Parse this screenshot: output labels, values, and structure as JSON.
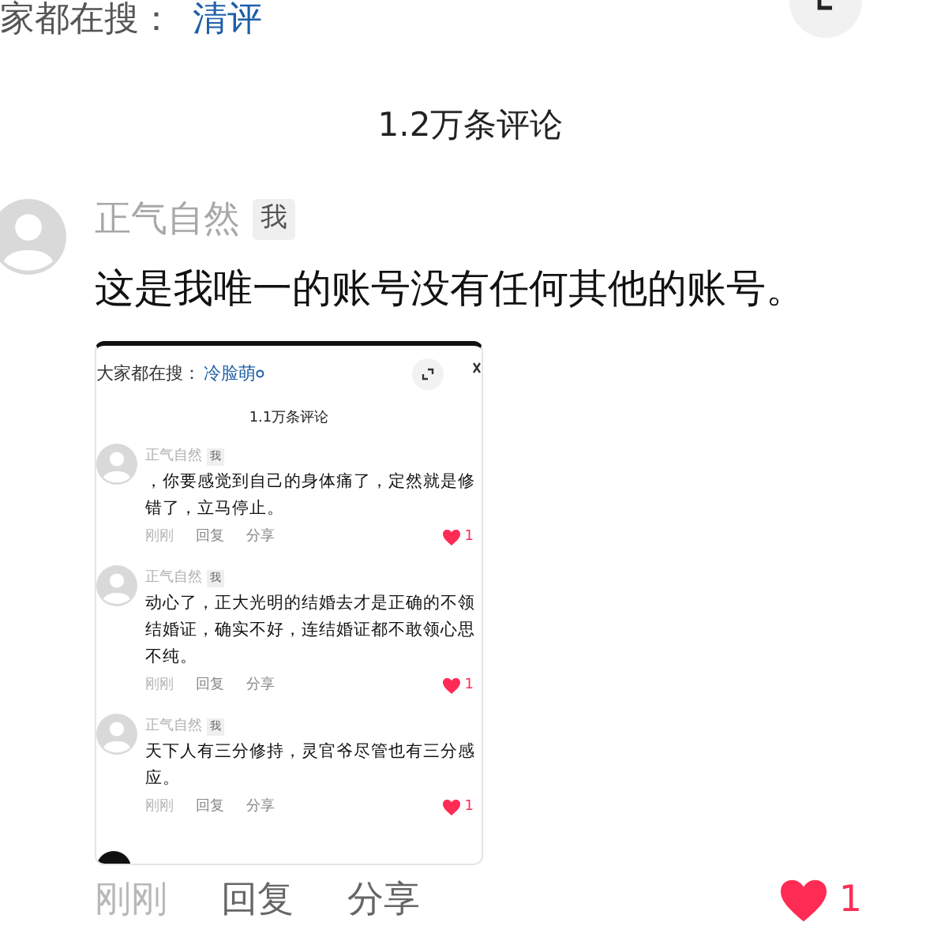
{
  "search_bar": {
    "label": "家都在搜：",
    "keyword": "清评"
  },
  "comment_count": "1.2万条评论",
  "comment": {
    "author": "正气自然",
    "badge": "我",
    "text": "这是我唯一的账号没有任何其他的账号。",
    "time": "刚刚",
    "actions": [
      "回复",
      "分享"
    ],
    "likes": "1",
    "liked": true,
    "screenshot": {
      "search_label": "大家都在搜：",
      "keyword": "冷脸萌",
      "comment_count": "1.1万条评论",
      "comments": [
        {
          "author": "正气自然",
          "badge": "我",
          "text": "，你要感觉到自己的身体痛了，定然就是修错了，立马停止。",
          "time": "刚刚",
          "actions": [
            "回复",
            "分享"
          ],
          "likes": "1",
          "liked": true
        },
        {
          "author": "正气自然",
          "badge": "我",
          "text": "动心了，正大光明的结婚去才是正确的不领结婚证，确实不好，连结婚证都不敢领心思不纯。",
          "time": "刚刚",
          "actions": [
            "回复",
            "分享"
          ],
          "likes": "1",
          "liked": true
        },
        {
          "author": "正气自然",
          "badge": "我",
          "text": "天下人有三分修持，灵官爷尽管也有三分感应。",
          "time": "刚刚",
          "actions": [
            "回复",
            "分享"
          ],
          "likes": "1",
          "liked": true
        }
      ]
    }
  }
}
